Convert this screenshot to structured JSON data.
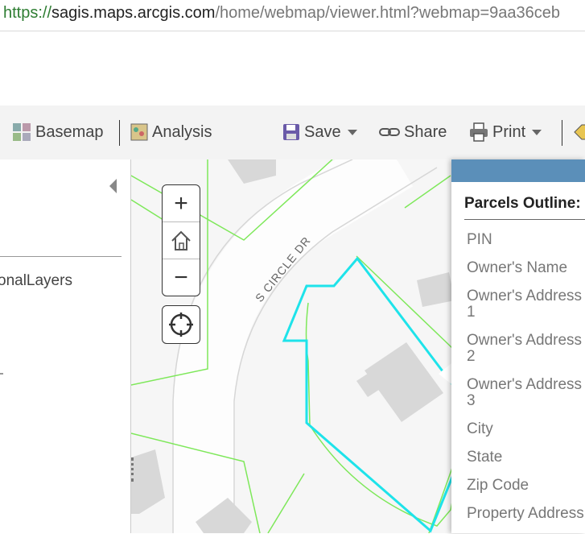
{
  "browser": {
    "url_scheme": "https://",
    "url_host": "sagis.maps.arcgis.com",
    "url_path": "/home/webmap/viewer.html?webmap=9aa36ceb"
  },
  "toolbar": {
    "basemap_label": "Basemap",
    "analysis_label": "Analysis",
    "save_label": "Save",
    "share_label": "Share",
    "print_label": "Print"
  },
  "sidebar": {
    "layer_label": "onalLayers"
  },
  "map": {
    "street_label": "S CIRCLE DR",
    "zoom_in_label": "+",
    "zoom_out_label": "−"
  },
  "popup": {
    "title": "Parcels Outline:",
    "fields": [
      "PIN",
      "Owner's Name",
      "Owner's Address",
      "1",
      "Owner's Address",
      "2",
      "Owner's Address",
      "3",
      "City",
      "State",
      "Zip Code",
      "Property Address"
    ]
  },
  "colors": {
    "parcel_line": "#7ee85a",
    "selection_outline": "#1ee3ea",
    "popup_header": "#5b8fb9"
  }
}
